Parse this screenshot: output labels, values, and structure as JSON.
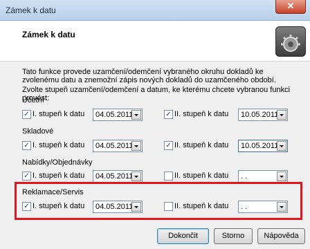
{
  "window": {
    "title": "Zámek k datu",
    "close_glyph": "✕"
  },
  "header": {
    "title": "Zámek k datu",
    "icon": "gear-icon"
  },
  "description": {
    "line1": "Tato funkce provede uzamčení/odemčení vybraného okruhu dokladů ke zvolenému datu a znemožní zápis nových dokladů do uzamčeného období.",
    "line2": "Zvolte stupeň uzamčení/odemčení a datum, ke kterému chcete vybranou funkci provést:"
  },
  "sections": [
    {
      "title": "Účetní",
      "first": {
        "label": "I. stupeň k datu",
        "checked": true,
        "date": "04.05.2011"
      },
      "second": {
        "label": "II. stupeň k datu",
        "checked": true,
        "date": "10.05.2011"
      }
    },
    {
      "title": "Skladové",
      "first": {
        "label": "I. stupeň k datu",
        "checked": true,
        "date": "04.05.2011"
      },
      "second": {
        "label": "II. stupeň k datu",
        "checked": true,
        "date": "10.05.2011"
      }
    },
    {
      "title": "Nabídky/Objednávky",
      "first": {
        "label": "I. stupeň k datu",
        "checked": true,
        "date": "04.05.2011"
      },
      "second": {
        "label": "II. stupeň k datu",
        "checked": false,
        "date": " .  ."
      }
    },
    {
      "title": "Reklamace/Servis",
      "first": {
        "label": "I. stupeň k datu",
        "checked": true,
        "date": "04.05.2011"
      },
      "second": {
        "label": "II. stupeň k datu",
        "checked": false,
        "date": " .  ."
      }
    }
  ],
  "check_glyph": "✓",
  "buttons": {
    "finish": "Dokončit",
    "cancel": "Storno",
    "help": "Nápověda"
  },
  "colors": {
    "highlight": "#e4141c",
    "titlebar": "#b9d1ea"
  }
}
